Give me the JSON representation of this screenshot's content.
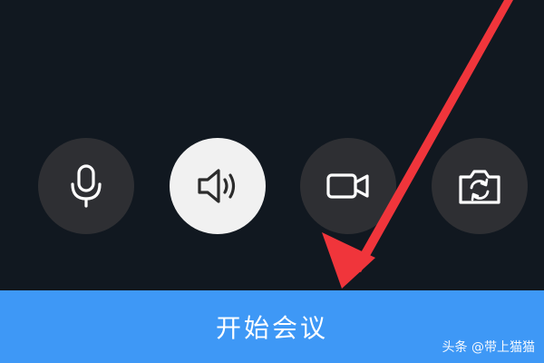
{
  "controls": {
    "microphone": {
      "icon": "microphone-icon",
      "active": false
    },
    "speaker": {
      "icon": "speaker-icon",
      "active": true
    },
    "camera": {
      "icon": "video-camera-icon",
      "active": false
    },
    "switch_camera": {
      "icon": "switch-camera-icon",
      "active": false
    }
  },
  "start_button": {
    "label": "开始会议"
  },
  "watermark": {
    "text": "头条 @带上猫猫"
  },
  "colors": {
    "background": "#111820",
    "button_inactive": "#2e2f33",
    "button_active": "#f1f1f1",
    "primary": "#3e98f6",
    "arrow": "#f0353b"
  }
}
